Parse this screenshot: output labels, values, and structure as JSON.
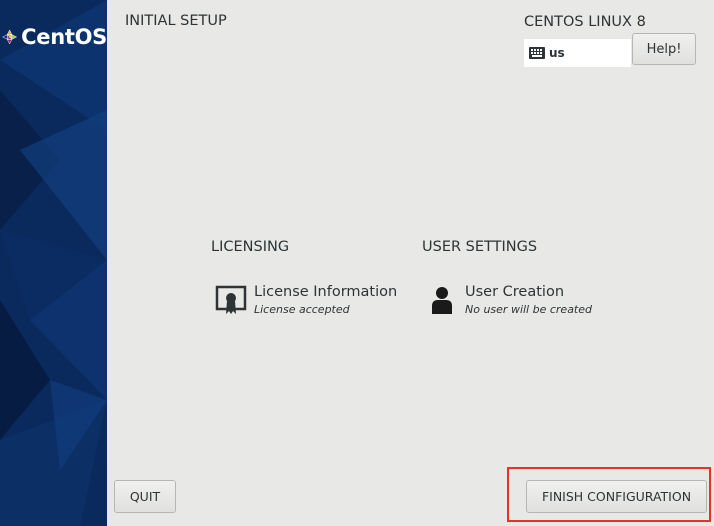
{
  "sidebar": {
    "logo_text": "CentOS",
    "logo_icon": "centos-logo-icon"
  },
  "header": {
    "title": "INITIAL SETUP",
    "product": "CENTOS LINUX 8",
    "keyboard_layout": "us",
    "keyboard_icon": "keyboard-icon",
    "help_label": "Help!"
  },
  "sections": [
    {
      "heading": "LICENSING",
      "spoke": {
        "title": "License Information",
        "status": "License accepted",
        "icon": "license-certificate-icon"
      }
    },
    {
      "heading": "USER SETTINGS",
      "spoke": {
        "title": "User Creation",
        "status": "No user will be created",
        "icon": "user-icon"
      }
    }
  ],
  "footer": {
    "quit_label": "QUIT",
    "finish_label": "FINISH CONFIGURATION"
  },
  "colors": {
    "sidebar": "#0a2a5e",
    "background": "#e8e8e7",
    "highlight": "#e8312a"
  }
}
